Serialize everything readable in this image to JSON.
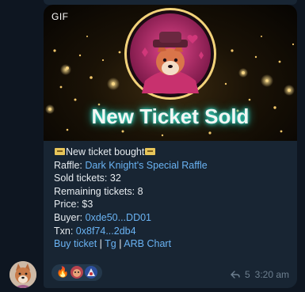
{
  "media": {
    "badge": "GIF",
    "banner_text": "New Ticket Sold"
  },
  "caption": {
    "headline": "New ticket bought",
    "raffle_label": "Raffle:",
    "raffle_name": "Dark Knight's Special Raffle",
    "sold": "Sold tickets: 32",
    "remaining": "Remaining tickets: 8",
    "price": "Price: $3",
    "buyer_label": "Buyer:",
    "buyer_address": "0xde50...DD01",
    "txn_label": "Txn:",
    "txn_hash": "0x8f74...2db4",
    "links": [
      "Buy ticket",
      "Tg",
      "ARB Chart"
    ],
    "link_separator": "|"
  },
  "reactions": {
    "first_emoji": "🔥"
  },
  "meta": {
    "views": "5",
    "time": "3:20 am"
  },
  "colors": {
    "bubble": "#182533",
    "link": "#6ab3f3",
    "background": "#0e1621",
    "banner_glow": "#19c2b0"
  }
}
